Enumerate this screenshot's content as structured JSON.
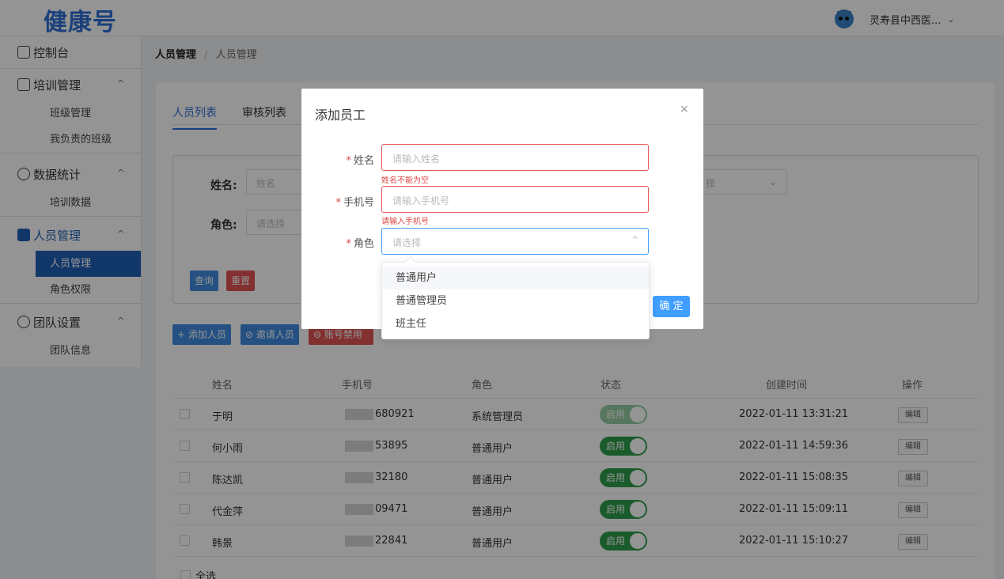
{
  "header": {
    "logo": "健康号",
    "org": "灵寿县中西医...",
    "caret": "⌄"
  },
  "sidebar": {
    "dashboard": "控制台",
    "groups": [
      {
        "label": "培训管理",
        "items": [
          "班级管理",
          "我负责的班级"
        ]
      },
      {
        "label": "数据统计",
        "items": [
          "培训数据"
        ]
      },
      {
        "label": "人员管理",
        "items": [
          "人员管理",
          "角色权限"
        ]
      },
      {
        "label": "团队设置",
        "items": [
          "团队信息"
        ]
      }
    ],
    "collapse_glyph": "^"
  },
  "breadcrumb": {
    "parent": "人员管理",
    "sep": "/",
    "current": "人员管理"
  },
  "tabs": [
    "人员列表",
    "审核列表"
  ],
  "filter": {
    "name_label": "姓名:",
    "name_placeholder": "姓名",
    "role_label": "角色:",
    "role_placeholder": "请选择",
    "hidden_select": "择",
    "query": "查询",
    "reset": "重置"
  },
  "actions": {
    "add": "+ 添加人员",
    "invite": "⊘ 邀请人员",
    "disable": "⊖ 账号禁用"
  },
  "table": {
    "headers": [
      "姓名",
      "手机号",
      "角色",
      "状态",
      "创建时间",
      "操作"
    ],
    "rows": [
      {
        "name": "于明",
        "phone": "680921",
        "role": "系统管理员",
        "status": "启用",
        "created": "2022-01-11 13:31:21",
        "op": "编辑"
      },
      {
        "name": "何小雨",
        "phone": "53895",
        "role": "普通用户",
        "status": "启用",
        "created": "2022-01-11 14:59:36",
        "op": "编辑"
      },
      {
        "name": "陈达凯",
        "phone": "32180",
        "role": "普通用户",
        "status": "启用",
        "created": "2022-01-11 15:08:35",
        "op": "编辑"
      },
      {
        "name": "代金萍",
        "phone": "09471",
        "role": "普通用户",
        "status": "启用",
        "created": "2022-01-11 15:09:11",
        "op": "编辑"
      },
      {
        "name": "韩景",
        "phone": "22841",
        "role": "普通用户",
        "status": "启用",
        "created": "2022-01-11 15:10:27",
        "op": "编辑"
      }
    ],
    "select_all": "全选"
  },
  "modal": {
    "title": "添加员工",
    "close": "×",
    "required_mark": "*",
    "name_label": "姓名",
    "name_placeholder": "请输入姓名",
    "name_error": "姓名不能为空",
    "phone_label": "手机号",
    "phone_placeholder": "请输入手机号",
    "phone_error": "请输入手机号",
    "role_label": "角色",
    "role_placeholder": "请选择",
    "role_arrow": "^",
    "confirm": "确 定"
  },
  "dropdown": {
    "options": [
      "普通用户",
      "普通管理员",
      "班主任"
    ]
  }
}
